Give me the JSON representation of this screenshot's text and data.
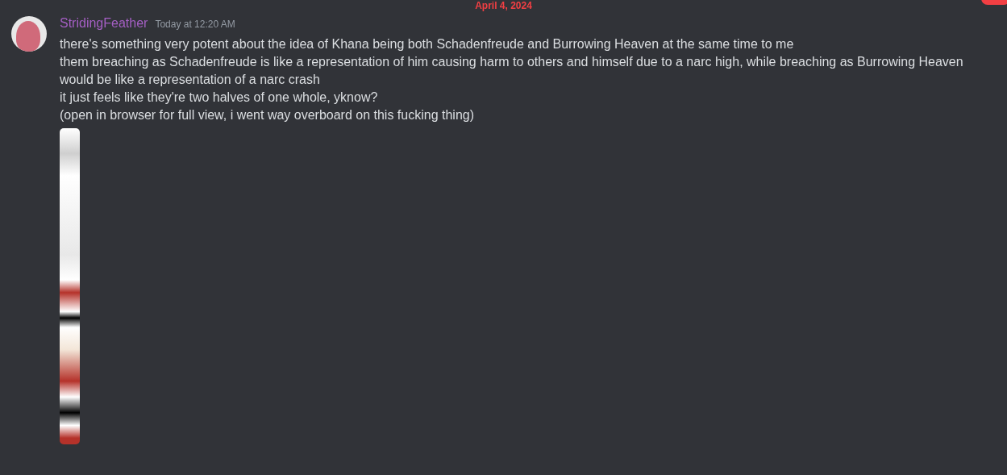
{
  "divider": {
    "date": "April 4, 2024",
    "new_badge": true
  },
  "message": {
    "author": "StridingFeather",
    "timestamp": "Today at 12:20 AM",
    "lines": [
      "there's something very potent about the idea of Khana being both Schadenfreude and Burrowing Heaven at the same time to me",
      "them breaching as Schadenfreude is like a representation of him causing harm to others and himself due to a narc high, while breaching as Burrowing Heaven would be like a representation of a narc crash",
      "it just feels like they're two halves of one whole, yknow?",
      "(open in browser for full view, i went way overboard on this fucking thing)"
    ],
    "attachment": {
      "kind": "image"
    }
  }
}
